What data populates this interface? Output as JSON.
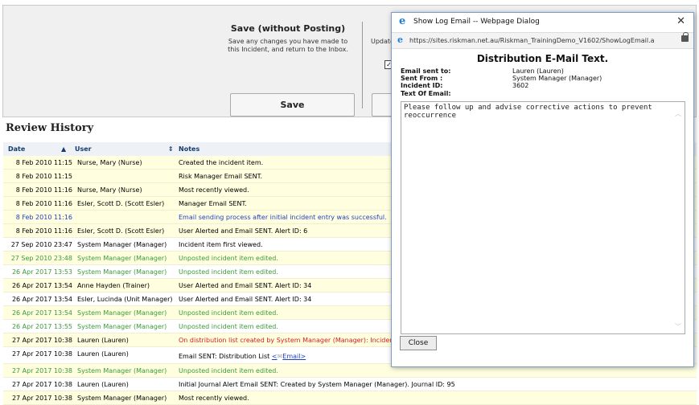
{
  "top_panel": {
    "save_title": "Save (without Posting)",
    "save_desc": "Save any changes you have made to this Incident, and return to the Inbox.",
    "update_label": "Update",
    "save_button": "Save"
  },
  "review": {
    "title": "Review History",
    "headers": {
      "date": "Date",
      "user": "User",
      "notes": "Notes"
    },
    "rows": [
      {
        "date": "8 Feb 2010 11:15",
        "user": "Nurse, Mary (Nurse)",
        "notes": "Created the incident item."
      },
      {
        "date": "8 Feb 2010 11:15",
        "user": "",
        "notes": "Risk Manager Email SENT."
      },
      {
        "date": "8 Feb 2010 11:16",
        "user": "Nurse, Mary (Nurse)",
        "notes": "Most recently viewed."
      },
      {
        "date": "8 Feb 2010 11:16",
        "user": "Esler, Scott D. (Scott Esler)",
        "notes": "Manager Email SENT."
      },
      {
        "date": "8 Feb 2010 11:16",
        "user": "",
        "notes": "Email sending process after initial incident entry was successful."
      },
      {
        "date": "8 Feb 2010 11:16",
        "user": "Esler, Scott D. (Scott Esler)",
        "notes": "User Alerted and Email SENT. Alert ID: 6"
      },
      {
        "date": "27 Sep 2010 23:47",
        "user": "System Manager (Manager)",
        "notes": "Incident item first viewed."
      },
      {
        "date": "27 Sep 2010 23:48",
        "user": "System Manager (Manager)",
        "notes": "Unposted incident item edited."
      },
      {
        "date": "26 Apr 2017 13:53",
        "user": "System Manager (Manager)",
        "notes": "Unposted incident item edited."
      },
      {
        "date": "26 Apr 2017 13:54",
        "user": "Anne Hayden (Trainer)",
        "notes": "User Alerted and Email SENT. Alert ID: 34"
      },
      {
        "date": "26 Apr 2017 13:54",
        "user": "Esler, Lucinda (Unit Manager)",
        "notes": "User Alerted and Email SENT. Alert ID: 34"
      },
      {
        "date": "26 Apr 2017 13:54",
        "user": "System Manager (Manager)",
        "notes": "Unposted incident item edited."
      },
      {
        "date": "26 Apr 2017 13:55",
        "user": "System Manager (Manager)",
        "notes": "Unposted incident item edited."
      },
      {
        "date": "27 Apr 2017 10:38",
        "user": "Lauren (Lauren)",
        "notes": "On distribution list created by System Manager (Manager): Incident"
      },
      {
        "date": "27 Apr 2017 10:38",
        "user": "Lauren (Lauren)",
        "notes": "Email SENT: Distribution List",
        "link": "Email>"
      },
      {
        "date": "27 Apr 2017 10:38",
        "user": "System Manager (Manager)",
        "notes": "Unposted incident item edited."
      },
      {
        "date": "27 Apr 2017 10:38",
        "user": "Lauren (Lauren)",
        "notes": "Initial Journal Alert Email SENT: Created by System Manager (Manager). Journal ID: 95"
      },
      {
        "date": "27 Apr 2017 10:38",
        "user": "System Manager (Manager)",
        "notes": "Most recently viewed."
      }
    ]
  },
  "dialog": {
    "title": "Show Log Email -- Webpage Dialog",
    "url": "https://sites.riskman.net.au/Riskman_TrainingDemo_V1602/ShowLogEmail.a",
    "heading": "Distribution E-Mail Text.",
    "email_sent_to_label": "Email sent to:",
    "email_sent_to": "Lauren (Lauren)",
    "sent_from_label": "Sent From :",
    "sent_from": "System Manager (Manager)",
    "incident_id_label": "Incident ID:",
    "incident_id": "3602",
    "text_label": "Text Of Email:",
    "email_text": "Please follow up and advise corrective actions to prevent reoccurrence",
    "close_button": "Close"
  },
  "colors": {
    "green": "#3a9a3a",
    "blue": "#1f3fc7",
    "red": "#d62020",
    "highlight": "#ffffe0"
  }
}
